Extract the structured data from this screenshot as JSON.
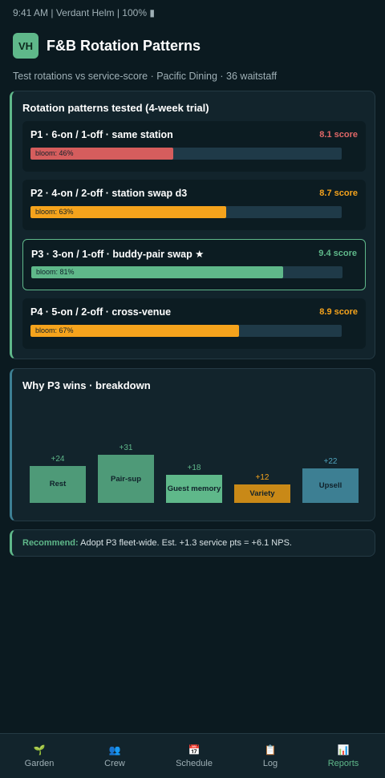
{
  "status": {
    "time": "9:41 AM",
    "app": "Verdant Helm",
    "battery": "100%"
  },
  "status_text": "9:41 AM | Verdant Helm | 100% ▮",
  "header": {
    "logo": "VH",
    "title": "F&B Rotation Patterns"
  },
  "subtitle": "Test rotations vs service-score · Pacific Dining · 36 waitstaff",
  "patterns": {
    "title": "Rotation patterns tested (4-week trial)",
    "items": [
      {
        "name": "P1 · 6-on / 1-off · same station",
        "score": "8.1 score",
        "bloom_label": "bloom: 46%",
        "bloom": 0.46,
        "color": "#d55d5d"
      },
      {
        "name": "P2 · 4-on / 2-off · station swap d3",
        "score": "8.7 score",
        "bloom_label": "bloom: 63%",
        "bloom": 0.63,
        "color": "#f5a31c"
      },
      {
        "name": "P3 · 3-on / 1-off · buddy-pair swap ★",
        "score": "9.4 score",
        "bloom_label": "bloom: 81%",
        "bloom": 0.81,
        "color": "#5fb88a"
      },
      {
        "name": "P4 · 5-on / 2-off · cross-venue",
        "score": "8.9 score",
        "bloom_label": "bloom: 67%",
        "bloom": 0.67,
        "color": "#f5a31c"
      }
    ]
  },
  "breakdown": {
    "title": "Why P3 wins · breakdown"
  },
  "chart_data": {
    "type": "bar",
    "categories": [
      "Rest",
      "Pair-sup",
      "Guest memory",
      "Variety",
      "Upsell"
    ],
    "values": [
      24,
      31,
      18,
      12,
      22
    ],
    "value_labels": [
      "+24",
      "+31",
      "+18",
      "+12",
      "+22"
    ],
    "colors": [
      "#4e9a78",
      "#4e9a78",
      "#5fb88a",
      "#c98917",
      "#3d7f93"
    ],
    "label_colors": [
      "#5fb88a",
      "#5fb88a",
      "#5fb88a",
      "#f5a31c",
      "#4fa3bd"
    ]
  },
  "recommend": {
    "label": "Recommend:",
    "text": " Adopt P3 fleet-wide. Est. +1.3 service pts = +6.1 NPS."
  },
  "nav": [
    {
      "icon": "🌱",
      "label": "Garden",
      "active": false
    },
    {
      "icon": "👥",
      "label": "Crew",
      "active": false
    },
    {
      "icon": "📅",
      "label": "Schedule",
      "active": false
    },
    {
      "icon": "📋",
      "label": "Log",
      "active": false
    },
    {
      "icon": "📊",
      "label": "Reports",
      "active": true
    }
  ]
}
